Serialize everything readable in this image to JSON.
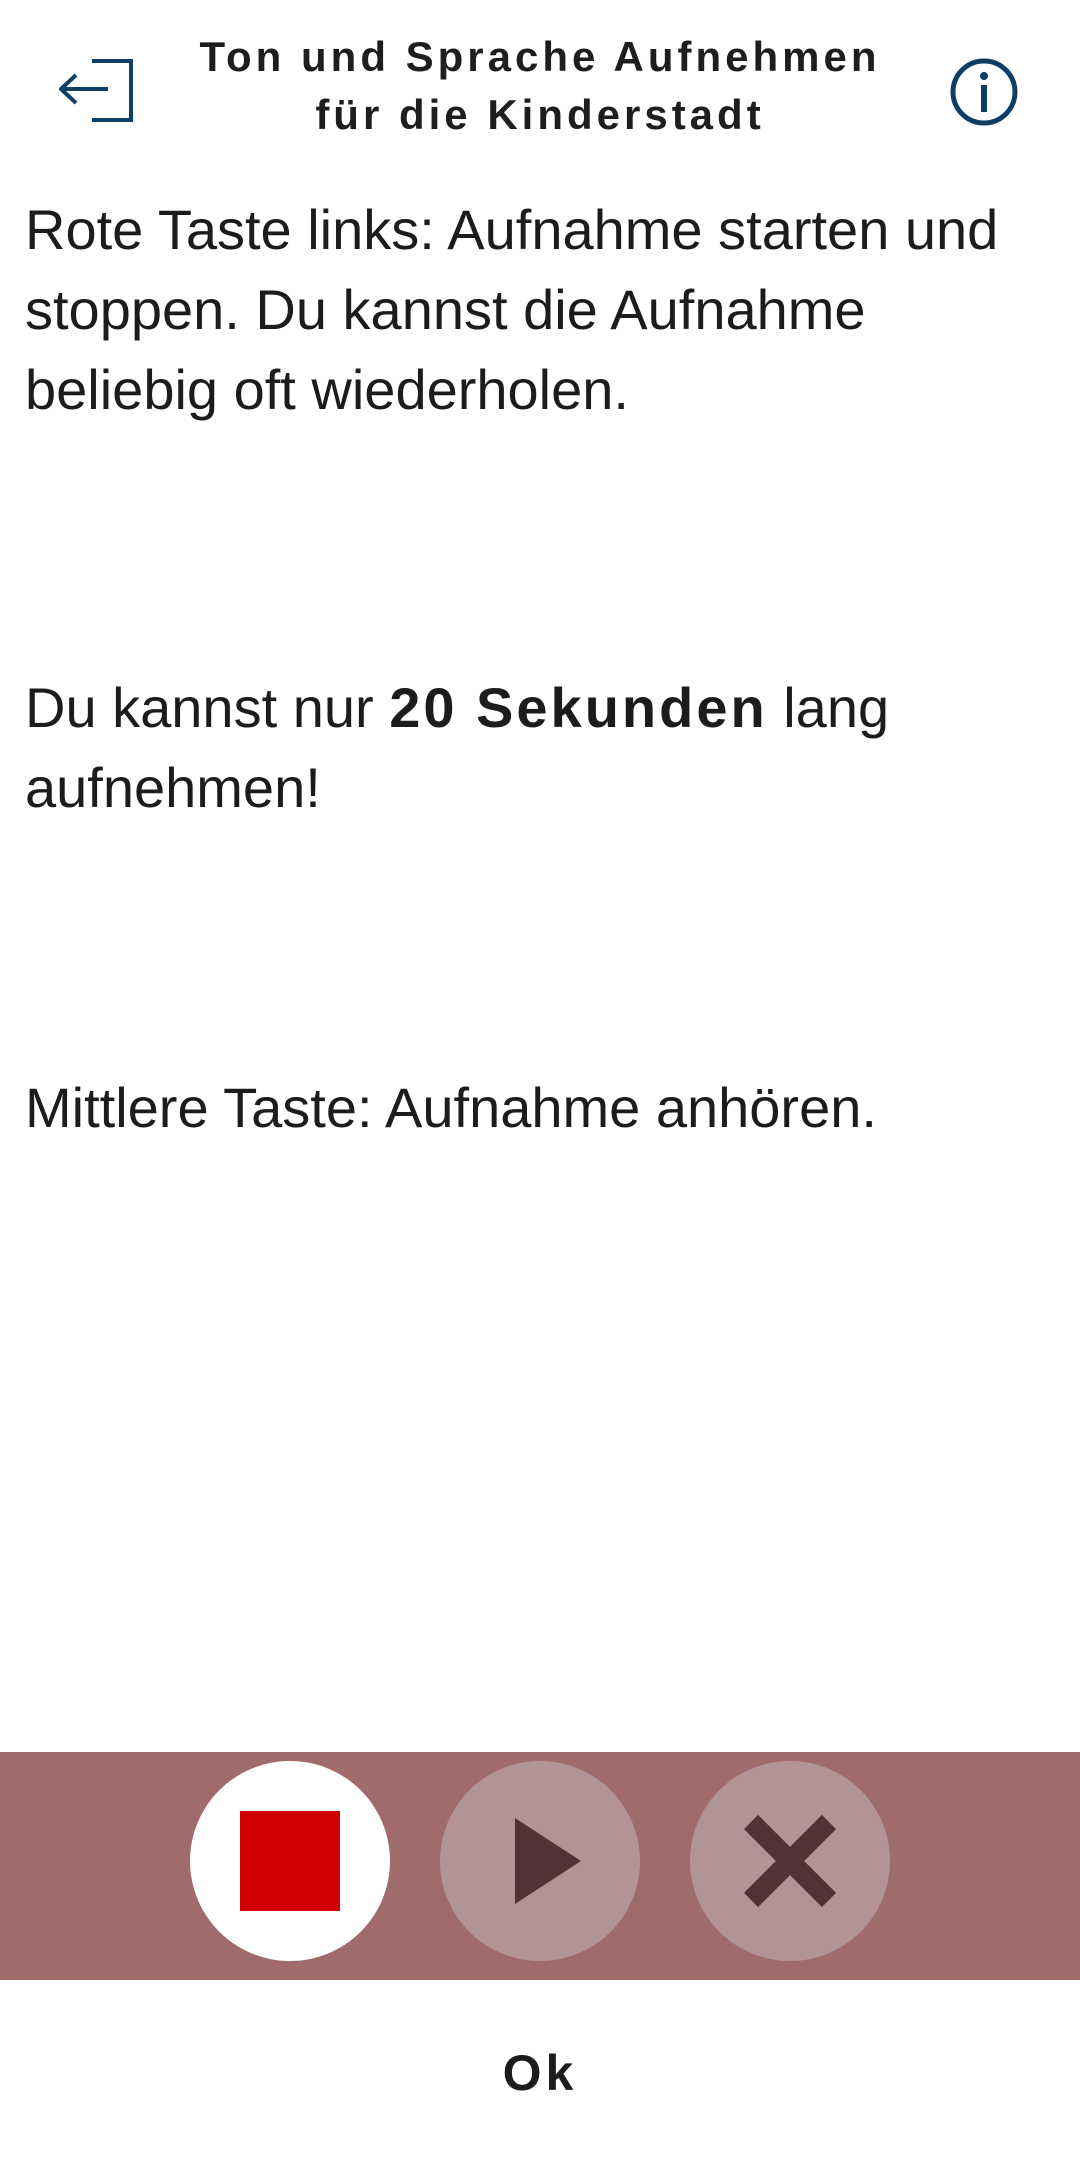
{
  "header": {
    "title_line1": "Ton und Sprache Aufnehmen",
    "title_line2": "für die Kinderstadt",
    "back_icon": "exit-arrow-icon",
    "info_icon": "info-circle-icon",
    "accent_color": "#0d3f66"
  },
  "instructions": {
    "para1": "Rote Taste links: Aufnahme starten und stoppen. Du kannst die Aufnahme beliebig oft wiederholen.",
    "para2_pre": "Du kannst nur ",
    "para2_emphasis": "20 Sekunden",
    "para2_post": " lang aufnehmen!",
    "para3": "Mittlere Taste: Aufnahme anhören."
  },
  "controls": {
    "bar_color": "#a06b6b",
    "record_icon": "stop-square-icon",
    "record_color": "#d10000",
    "play_icon": "play-icon",
    "cancel_icon": "close-x-icon",
    "icon_color": "#4f3337"
  },
  "footer": {
    "ok_label": "Ok"
  }
}
